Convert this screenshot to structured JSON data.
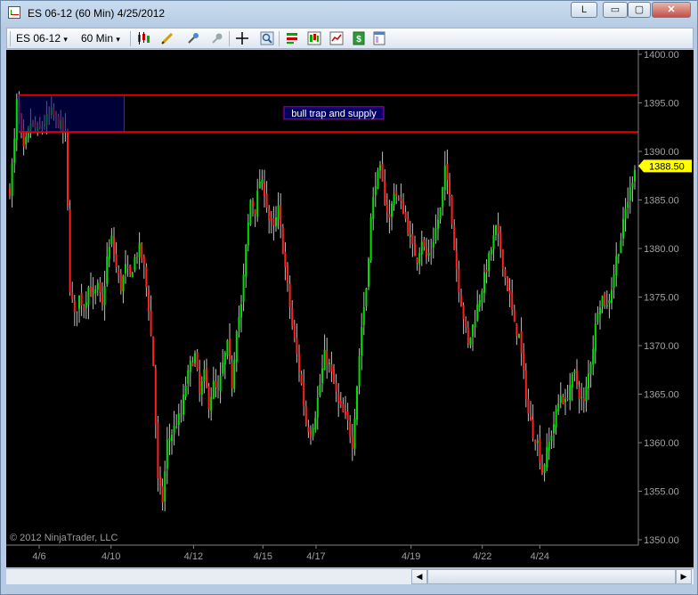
{
  "window": {
    "title": "ES 06-12 (60 Min)  4/25/2012",
    "button_l": "L",
    "button_min": "▭",
    "button_max": "▢",
    "button_close": "✕"
  },
  "toolbar": {
    "instrument": "ES 06-12",
    "instrument_arrow": "▾",
    "interval": "60 Min",
    "interval_arrow": "▾"
  },
  "icons": [
    "candlestick-style-icon",
    "pencil-draw-icon",
    "pin-icon",
    "magnet-icon",
    "crosshair-icon",
    "zoom-icon",
    "strategy-icon",
    "indicator-icon",
    "chart-properties-icon",
    "data-box-icon",
    "panel-icon"
  ],
  "colors": {
    "up_bar": "#00e000",
    "down_bar": "#ff2020",
    "doji": "#c0c0c0",
    "supply_line": "#e00000",
    "supply_box": "#000066",
    "price_marker": "#ffff00"
  },
  "chart_data": {
    "type": "ohlc",
    "instrument": "ES 06-12",
    "interval": "60 Min",
    "price_axis": {
      "ticks": [
        "1400.00",
        "1395.00",
        "1390.00",
        "1385.00",
        "1380.00",
        "1375.00",
        "1370.00",
        "1365.00",
        "1360.00",
        "1355.00",
        "1350.00"
      ],
      "min": 1350,
      "max": 1400
    },
    "time_axis": {
      "ticks": [
        "4/6",
        "4/10",
        "4/12",
        "4/15",
        "4/17",
        "4/19",
        "4/22",
        "4/24"
      ]
    },
    "last_price": "1388.50",
    "watermark": "© 2012 NinjaTrader, LLC",
    "annotation": {
      "text": "bull trap and supply",
      "upper": 1395.8,
      "lower": 1392.0
    },
    "path": [
      [
        0,
        1386
      ],
      [
        2,
        1391
      ],
      [
        3,
        1395
      ],
      [
        6,
        1390
      ],
      [
        9,
        1393
      ],
      [
        12,
        1392
      ],
      [
        15,
        1393
      ],
      [
        18,
        1394
      ],
      [
        21,
        1393
      ],
      [
        24,
        1392
      ],
      [
        26,
        1376
      ],
      [
        28,
        1373
      ],
      [
        30,
        1375
      ],
      [
        32,
        1374
      ],
      [
        34,
        1376
      ],
      [
        36,
        1375
      ],
      [
        38,
        1376
      ],
      [
        40,
        1374
      ],
      [
        42,
        1379
      ],
      [
        44,
        1381
      ],
      [
        46,
        1378
      ],
      [
        48,
        1376
      ],
      [
        50,
        1378
      ],
      [
        52,
        1377
      ],
      [
        54,
        1379
      ],
      [
        56,
        1380
      ],
      [
        58,
        1378
      ],
      [
        60,
        1374
      ],
      [
        62,
        1368
      ],
      [
        64,
        1356
      ],
      [
        66,
        1354
      ],
      [
        68,
        1360
      ],
      [
        70,
        1361
      ],
      [
        72,
        1362
      ],
      [
        74,
        1363
      ],
      [
        76,
        1366
      ],
      [
        78,
        1368
      ],
      [
        80,
        1369
      ],
      [
        82,
        1365
      ],
      [
        84,
        1367
      ],
      [
        86,
        1364
      ],
      [
        88,
        1366
      ],
      [
        90,
        1365
      ],
      [
        92,
        1368
      ],
      [
        94,
        1370
      ],
      [
        96,
        1366
      ],
      [
        98,
        1372
      ],
      [
        100,
        1374
      ],
      [
        102,
        1380
      ],
      [
        104,
        1385
      ],
      [
        106,
        1384
      ],
      [
        108,
        1387
      ],
      [
        110,
        1386
      ],
      [
        112,
        1383
      ],
      [
        114,
        1382
      ],
      [
        116,
        1384
      ],
      [
        118,
        1380
      ],
      [
        120,
        1376
      ],
      [
        122,
        1372
      ],
      [
        124,
        1369
      ],
      [
        126,
        1366
      ],
      [
        128,
        1362
      ],
      [
        130,
        1361
      ],
      [
        132,
        1363
      ],
      [
        134,
        1366
      ],
      [
        136,
        1369
      ],
      [
        138,
        1368
      ],
      [
        140,
        1366
      ],
      [
        142,
        1364
      ],
      [
        144,
        1363
      ],
      [
        146,
        1362
      ],
      [
        148,
        1360
      ],
      [
        150,
        1366
      ],
      [
        152,
        1372
      ],
      [
        154,
        1376
      ],
      [
        156,
        1383
      ],
      [
        158,
        1387
      ],
      [
        160,
        1388
      ],
      [
        162,
        1385
      ],
      [
        164,
        1383
      ],
      [
        166,
        1386
      ],
      [
        168,
        1385
      ],
      [
        170,
        1384
      ],
      [
        172,
        1382
      ],
      [
        174,
        1380
      ],
      [
        176,
        1379
      ],
      [
        178,
        1381
      ],
      [
        180,
        1379
      ],
      [
        182,
        1380
      ],
      [
        184,
        1382
      ],
      [
        186,
        1384
      ],
      [
        188,
        1388
      ],
      [
        190,
        1386
      ],
      [
        192,
        1380
      ],
      [
        194,
        1376
      ],
      [
        196,
        1373
      ],
      [
        198,
        1370
      ],
      [
        200,
        1372
      ],
      [
        202,
        1374
      ],
      [
        204,
        1376
      ],
      [
        206,
        1378
      ],
      [
        208,
        1380
      ],
      [
        210,
        1382
      ],
      [
        212,
        1380
      ],
      [
        214,
        1377
      ],
      [
        216,
        1375
      ],
      [
        218,
        1372
      ],
      [
        220,
        1371
      ],
      [
        222,
        1367
      ],
      [
        224,
        1363
      ],
      [
        226,
        1361
      ],
      [
        228,
        1360
      ],
      [
        230,
        1357
      ],
      [
        232,
        1359
      ],
      [
        234,
        1361
      ],
      [
        236,
        1363
      ],
      [
        238,
        1365
      ],
      [
        240,
        1364
      ],
      [
        242,
        1366
      ],
      [
        244,
        1367
      ],
      [
        246,
        1365
      ],
      [
        248,
        1364
      ],
      [
        250,
        1367
      ],
      [
        252,
        1370
      ],
      [
        254,
        1374
      ],
      [
        256,
        1375
      ],
      [
        258,
        1374
      ],
      [
        260,
        1376
      ],
      [
        262,
        1379
      ],
      [
        264,
        1381
      ],
      [
        266,
        1384
      ],
      [
        268,
        1386
      ],
      [
        270,
        1388.5
      ]
    ]
  }
}
